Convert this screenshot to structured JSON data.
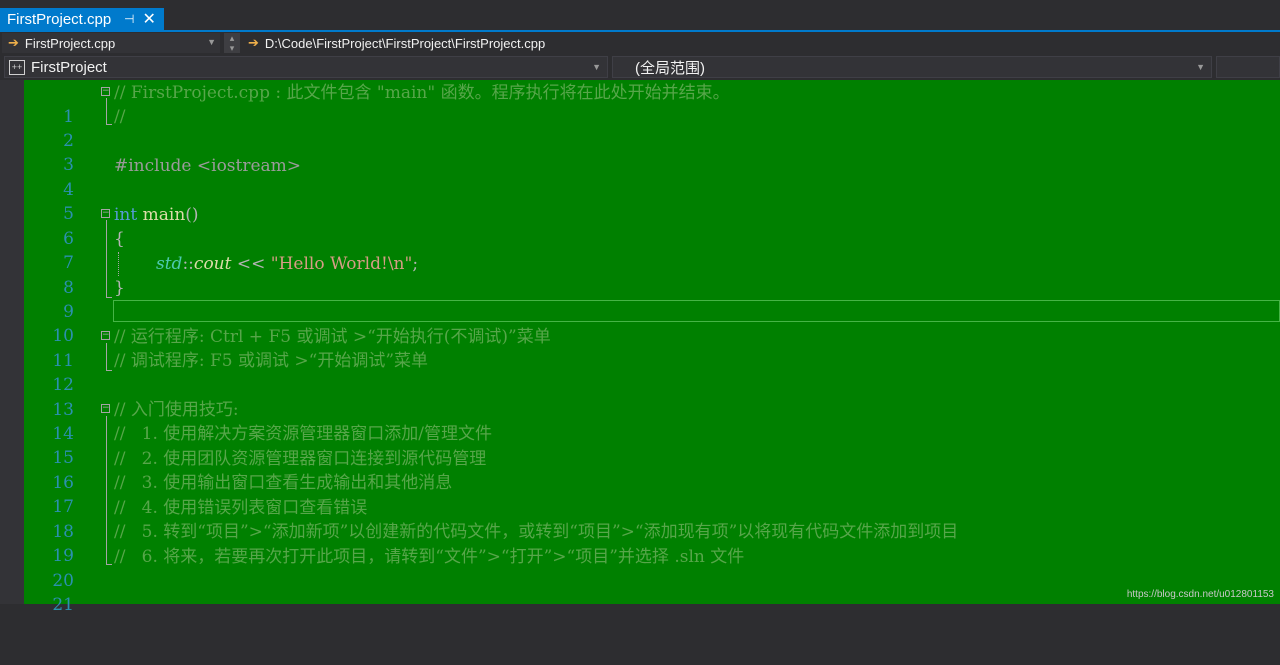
{
  "tab": {
    "title": "FirstProject.cpp",
    "pin": "⊣",
    "close": "✕"
  },
  "nav": {
    "file": "FirstProject.cpp",
    "path": "D:\\Code\\FirstProject\\FirstProject\\FirstProject.cpp",
    "project": "FirstProject",
    "scope": "(全局范围)"
  },
  "lines": [
    {
      "n": "1",
      "code": "// FirstProject.cpp : 此文件包含 \"main\" 函数。程序执行将在此处开始并结束。"
    },
    {
      "n": "2",
      "code": "//"
    },
    {
      "n": "3",
      "code": ""
    },
    {
      "n": "4",
      "code": "#include <iostream>"
    },
    {
      "n": "5",
      "code": ""
    },
    {
      "n": "6",
      "kw": "int",
      "fn": "main",
      "rest": "()"
    },
    {
      "n": "7",
      "code": "{"
    },
    {
      "n": "8",
      "ns": "std",
      "sep": "::",
      "var": "cout",
      "op": " << ",
      "str": "\"Hello World!\\n\"",
      "end": ";"
    },
    {
      "n": "9",
      "code": "}"
    },
    {
      "n": "10",
      "code": ""
    },
    {
      "n": "11",
      "code": "// 运行程序: Ctrl + F5 或调试 >“开始执行(不调试)”菜单"
    },
    {
      "n": "12",
      "code": "// 调试程序: F5 或调试 >“开始调试”菜单"
    },
    {
      "n": "13",
      "code": ""
    },
    {
      "n": "14",
      "code": "// 入门使用技巧:"
    },
    {
      "n": "15",
      "code": "//   1. 使用解决方案资源管理器窗口添加/管理文件"
    },
    {
      "n": "16",
      "code": "//   2. 使用团队资源管理器窗口连接到源代码管理"
    },
    {
      "n": "17",
      "code": "//   3. 使用输出窗口查看生成输出和其他消息"
    },
    {
      "n": "18",
      "code": "//   4. 使用错误列表窗口查看错误"
    },
    {
      "n": "19",
      "code": "//   5. 转到“项目”>“添加新项”以创建新的代码文件，或转到“项目”>“添加现有项”以将现有代码文件添加到项目"
    },
    {
      "n": "20",
      "code": "//   6. 将来，若要再次打开此项目，请转到“文件”>“打开”>“项目”并选择 .sln 文件"
    },
    {
      "n": "21",
      "code": ""
    }
  ],
  "watermark": "https://blog.csdn.net/u012801153"
}
